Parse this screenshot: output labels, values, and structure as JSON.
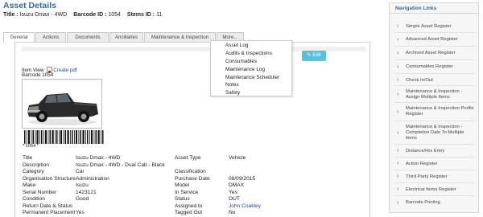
{
  "page": {
    "title": "Asset Details"
  },
  "title_line": {
    "title_label": "Title :",
    "title_value": "Isuzu Dmax - 4WD",
    "barcode_label": "Barcode ID :",
    "barcode_value": "1054",
    "stems_label": "Stems ID :",
    "stems_value": "11"
  },
  "tabs": [
    "General",
    "Actions",
    "Documents",
    "Ancillaries",
    "Maintenance & Inspection",
    "More..."
  ],
  "more_menu": [
    "Asset Log",
    "Audits & Inspections",
    "Consumables",
    "Maintenance Log",
    "Maintenance Scheduler",
    "Notes",
    "Safety"
  ],
  "edit_button": {
    "label": "Edit"
  },
  "item_view": {
    "label": "Item View",
    "pdf_link": "Create pdf",
    "barcode_label": "Barcode 1054"
  },
  "barcode_number": "* 1054 *",
  "details": [
    {
      "label": "Title",
      "value": "Isuzu Dmax - 4WD",
      "label2": "Asset Type",
      "value2": "Vehicle"
    },
    {
      "label": "Description",
      "value": "Isuzu Dmax - 4WD - Dual Cab - Black",
      "label2": "",
      "value2": ""
    },
    {
      "label": "Category",
      "value": "Car",
      "label2": "Classification",
      "value2": ""
    },
    {
      "label": "Organisation Structure",
      "value": "Administration",
      "label2": "Purchase Date",
      "value2": "08/09/2015"
    },
    {
      "label": "Make",
      "value": "Isuzu",
      "label2": "Model",
      "value2": "DMAX"
    },
    {
      "label": "Serial Number",
      "value": "1423121",
      "label2": "In Service",
      "value2": "Yes"
    },
    {
      "label": "Condition",
      "value": "Good",
      "label2": "Status",
      "value2": "OUT"
    },
    {
      "label": "Return Date & Status",
      "value": "",
      "label2": "Assigned to",
      "value2": "John Coakley"
    },
    {
      "label": "Permanent Placement",
      "value": "Yes",
      "label2": "Tagged Out",
      "value2": "No"
    }
  ],
  "nav": {
    "heading": "Navigation Links",
    "items": [
      "Simple Asset Register",
      "Advanced Asset Register",
      "Archived Asset Register",
      "Consumables Register",
      "Check In/Out",
      "Maintenance & Inspection - Assign Multiple Items",
      "Maintenance & Inspection Profile Register",
      "Maintenance & Inspection - Completion Date To Multiple items",
      "Distance/Hrs Entry",
      "Action Register",
      "Third Party Register",
      "Electrical Items Register",
      "Barcode Printing"
    ]
  },
  "colors": {
    "accent": "#2d6ca2",
    "edit_button": "#5bc0de",
    "link": "#1a4aa8"
  }
}
